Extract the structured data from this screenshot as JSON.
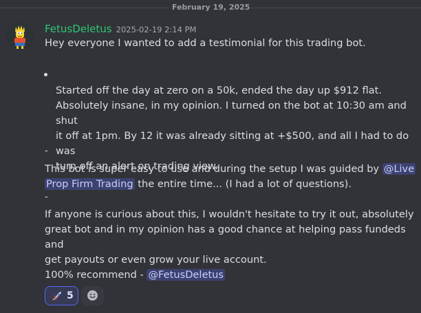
{
  "date_divider": "February 19, 2025",
  "message": {
    "username": "FetusDeletus",
    "timestamp": "2025-02-19 2:14 PM",
    "line1": "Hey everyone I wanted to add a testimonial for this trading bot.",
    "quote_lines": [
      "Started off the day at zero on a 50k, ended the day up $912 flat.",
      "Absolutely insane, in my opinion. I turned on the bot at 10:30 am and shut",
      "it off at 1pm. By 12 it was already sitting at +$500, and all I had to do was",
      "turn off an alert on trading view."
    ],
    "dash": "-",
    "para2_pre": "This bot is super easy to use and during the setup I was guided by ",
    "mention_live_line1": "@Live",
    "mention_live_line2": "Prop Firm Trading",
    "para2_post": " the entire time... (I had a lot of questions).",
    "para3_lines": [
      "If anyone is curious about this, I wouldn't hesitate to try it out, absolutely",
      "great bot and in my opinion has a good chance at helping pass fundeds and",
      "get payouts or even grow your live account."
    ],
    "recommend_text": "100% recommend - ",
    "mention_self": "@FetusDeletus"
  },
  "reactions": [
    {
      "emoji": "rocket-icon",
      "count": "5",
      "active": true
    }
  ],
  "add_reaction_icon": "smile-icon",
  "colors": {
    "background": "#323339",
    "username": "#2dc770",
    "mention_bg": "#3c4270",
    "mention_text": "#c9cdfb",
    "reaction_border": "#5865f2"
  }
}
